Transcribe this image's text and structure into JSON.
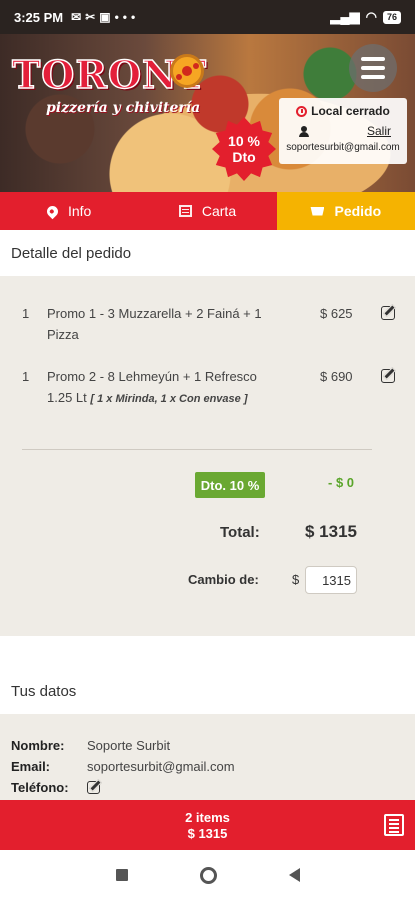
{
  "status_bar": {
    "time": "3:25 PM",
    "battery": "76"
  },
  "header": {
    "logo_title": "TORONT",
    "logo_subtitle": "pizzería y chivitería",
    "discount_badge_line1": "10 %",
    "discount_badge_line2": "Dto",
    "local_status": "Local cerrado",
    "logout_label": "Salir",
    "user_email": "soportesurbit@gmail.com"
  },
  "tabs": [
    {
      "label": "Info",
      "icon": "map-pin-icon"
    },
    {
      "label": "Carta",
      "icon": "menu-card-icon"
    },
    {
      "label": "Pedido",
      "icon": "cart-icon",
      "active": true
    }
  ],
  "order": {
    "section_title": "Detalle del pedido",
    "items": [
      {
        "qty": "1",
        "description": "Promo 1 - 3 Muzzarella + 2 Fainá + 1 Pizza",
        "detail": "",
        "price": "$ 625"
      },
      {
        "qty": "1",
        "description": "Promo 2 - 8 Lehmeyún + 1 Refresco 1.25 Lt",
        "detail": "[ 1 x Mirinda, 1 x Con envase ]",
        "price": "$ 690"
      }
    ],
    "discount_label": "Dto. 10 %",
    "discount_amount": "- $ 0",
    "total_label": "Total:",
    "total_value": "$ 1315",
    "change_label": "Cambio de:",
    "change_currency": "$",
    "change_value": "1315"
  },
  "user_data": {
    "section_title": "Tus datos",
    "name_label": "Nombre:",
    "name_value": "Soporte Surbit",
    "email_label": "Email:",
    "email_value": "soportesurbit@gmail.com",
    "phone_label": "Teléfono:"
  },
  "cart_bar": {
    "items_text": "2 items",
    "total_text": "$ 1315"
  },
  "colors": {
    "primary_red": "#e31f2d",
    "active_tab_yellow": "#f5b301",
    "discount_green": "#6aa832",
    "panel_beige": "#efece6"
  }
}
